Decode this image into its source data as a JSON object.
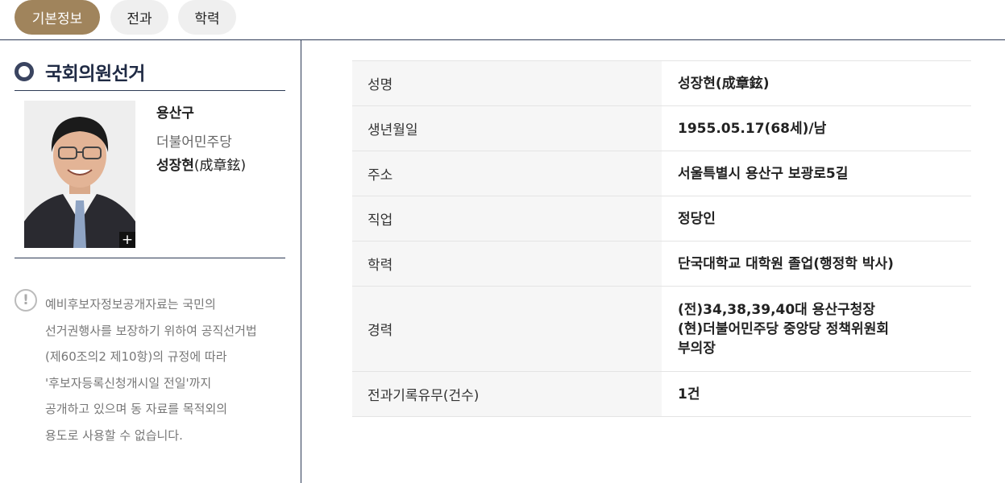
{
  "tabs": [
    {
      "label": "기본정보",
      "active": true
    },
    {
      "label": "전과",
      "active": false
    },
    {
      "label": "학력",
      "active": false
    }
  ],
  "sidebar": {
    "section_title": "국회의원선거",
    "district": "용산구",
    "party": "더불어민주당",
    "name_ko": "성장현",
    "name_hanja": "(成章鉉)",
    "photo_expand_label": "+",
    "notice_icon": "!",
    "notice_lines": [
      "예비후보자정보공개자료는 국민의",
      "선거권행사를 보장하기 위하여 공직선거법",
      "(제60조의2 제10항)의 규정에 따라",
      "'후보자등록신청개시일 전일'까지",
      "공개하고 있으며 동 자료를 목적외의",
      "용도로 사용할 수 없습니다."
    ]
  },
  "info": {
    "rows": [
      {
        "label": "성명",
        "value": "성장현(成章鉉)"
      },
      {
        "label": "생년월일",
        "value": "1955.05.17(68세)/남"
      },
      {
        "label": "주소",
        "value": "서울특별시 용산구 보광로5길"
      },
      {
        "label": "직업",
        "value": "정당인"
      },
      {
        "label": "학력",
        "value": "단국대학교 대학원 졸업(행정학 박사)"
      },
      {
        "label": "경력",
        "value_lines": [
          "(전)34,38,39,40대 용산구청장",
          "(현)더불어민주당 중앙당 정책위원회",
          "부의장"
        ]
      },
      {
        "label": "전과기록유무(건수)",
        "value": "1건"
      }
    ]
  },
  "colors": {
    "active_tab": "#a0845c",
    "rule": "#2d3a55"
  }
}
